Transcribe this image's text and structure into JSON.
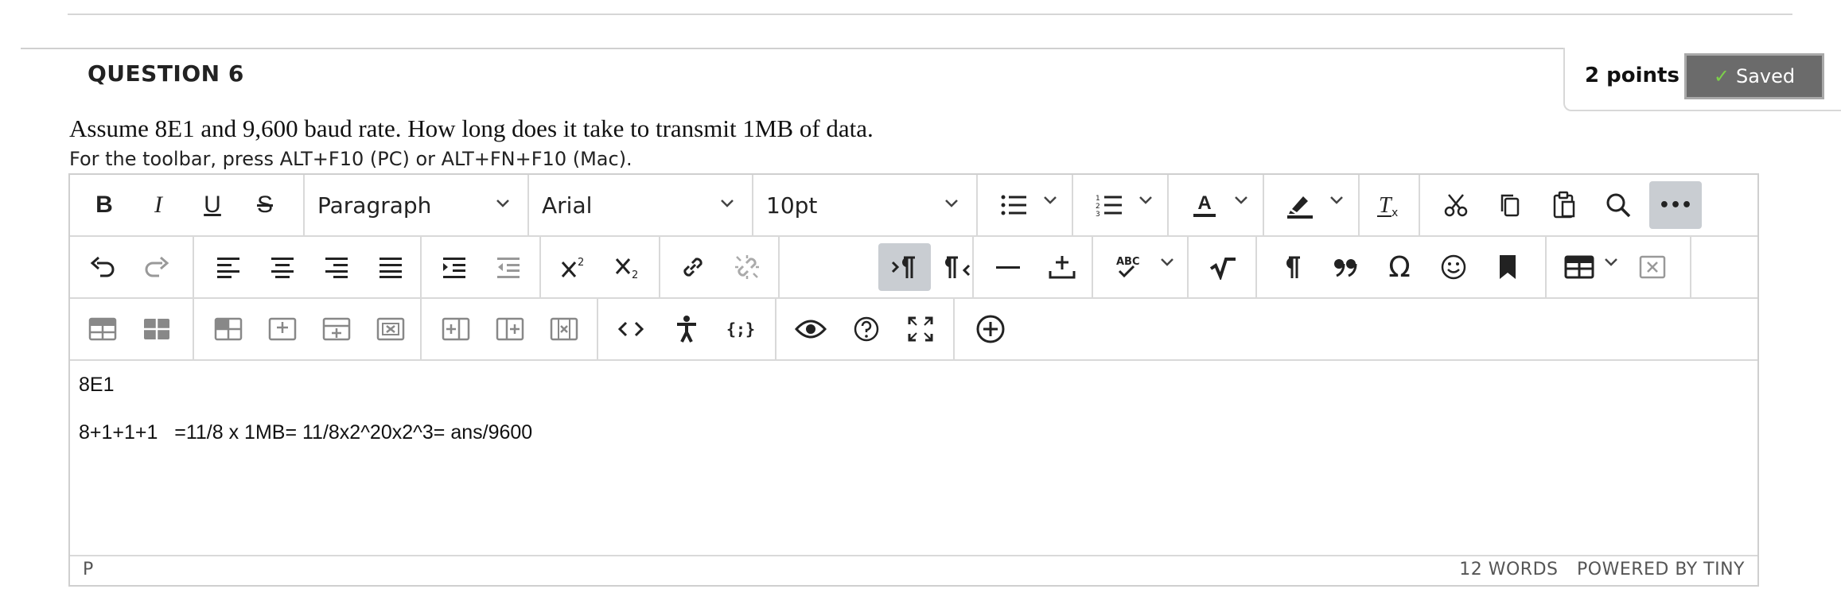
{
  "question": {
    "title": "QUESTION 6",
    "points": "2 points",
    "saved_label": "Saved",
    "text": "Assume 8E1 and 9,600 baud rate. How long does it take to transmit 1MB of data.",
    "toolbar_hint": "For the toolbar, press ALT+F10 (PC) or ALT+FN+F10 (Mac)."
  },
  "toolbar": {
    "bold": "B",
    "italic": "I",
    "underline": "U",
    "strike": "S",
    "block_format": "Paragraph",
    "font_family": "Arial",
    "font_size": "10pt",
    "special_char": "Ω",
    "more": "•••"
  },
  "editor": {
    "lines": [
      "8E1",
      "8+1+1+1   =11/8 x 1MB= 11/8x2^20x2^3= ans/9600"
    ],
    "status_path": "P",
    "word_count": "12 WORDS",
    "powered_by": "POWERED BY TINY"
  },
  "colors": {
    "accent_check": "#7cd04a",
    "saved_bg": "#6b6b6b",
    "active_button": "#c9cdd2"
  }
}
